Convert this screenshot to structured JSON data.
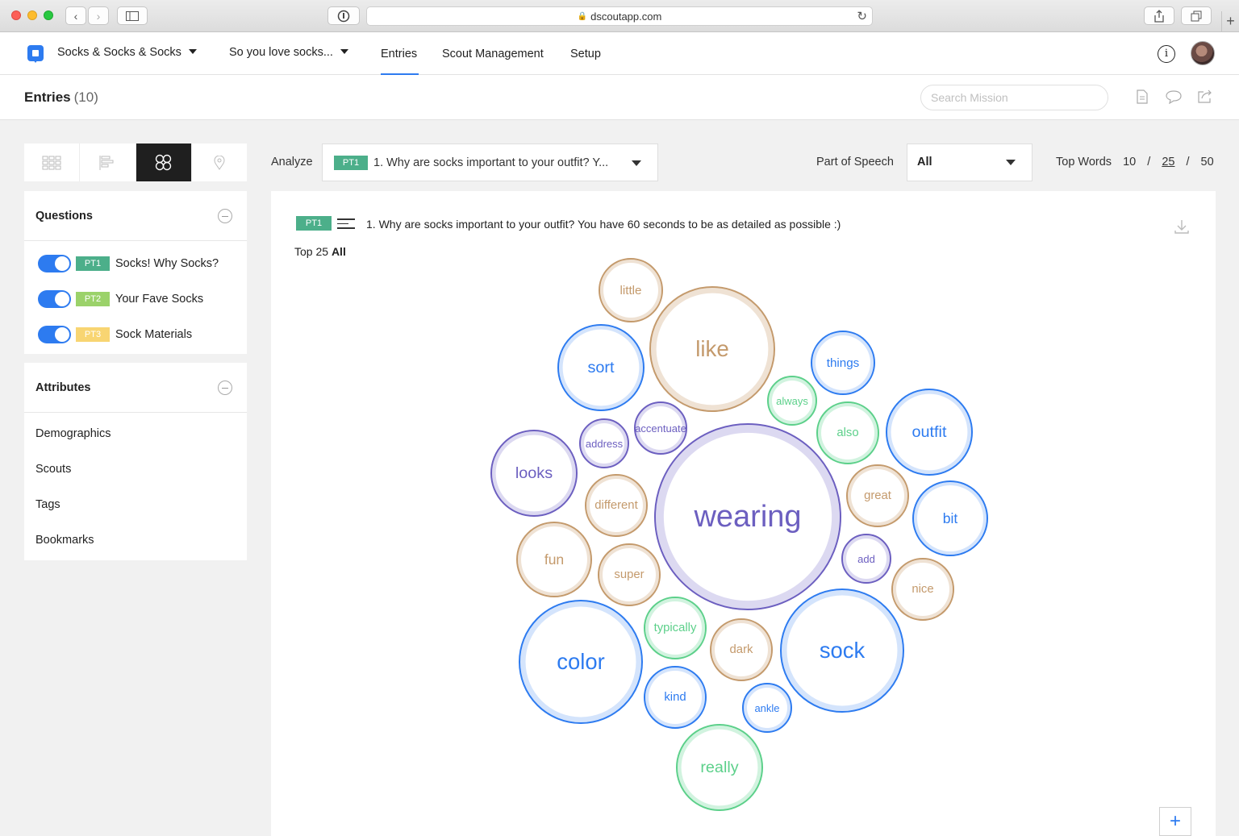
{
  "browser": {
    "url": "dscoutapp.com"
  },
  "nav": {
    "project": "Socks & Socks & Socks",
    "mission": "So you love socks...",
    "tabs": [
      "Entries",
      "Scout Management",
      "Setup"
    ],
    "info_icon": "info-icon"
  },
  "subheader": {
    "title": "Entries",
    "count": "(10)",
    "search_placeholder": "Search Mission"
  },
  "questions": {
    "heading": "Questions",
    "items": [
      {
        "badge": "PT1",
        "badge_color": "#4caf8a",
        "label": "Socks! Why Socks?"
      },
      {
        "badge": "PT2",
        "badge_color": "#9bd26a",
        "label": "Your Fave Socks"
      },
      {
        "badge": "PT3",
        "badge_color": "#f8d572",
        "label": "Sock Materials"
      }
    ]
  },
  "attributes": {
    "heading": "Attributes",
    "items": [
      "Demographics",
      "Scouts",
      "Tags",
      "Bookmarks"
    ]
  },
  "analyze": {
    "label": "Analyze",
    "badge": "PT1",
    "question": "1. Why are socks important to your outfit? Y...",
    "pos_label": "Part of Speech",
    "pos_value": "All",
    "top_words_label": "Top Words",
    "top_words_options": [
      "10",
      "25",
      "50"
    ],
    "top_words_selected": "25"
  },
  "panel": {
    "badge": "PT1",
    "question": "1. Why are socks important to your outfit? You have 60 seconds to be as detailed as possible :)",
    "top_label": "Top 25",
    "top_filter": "All"
  },
  "colors": {
    "blue": "#2d7bf0",
    "tan": "#c49a6c",
    "purple": "#6c5fc0",
    "green": "#5cd08a"
  },
  "bubbles": [
    {
      "word": "wearing",
      "color": "purple"
    },
    {
      "word": "like",
      "color": "tan"
    },
    {
      "word": "sock",
      "color": "blue"
    },
    {
      "word": "color",
      "color": "blue"
    },
    {
      "word": "sort",
      "color": "blue"
    },
    {
      "word": "outfit",
      "color": "blue"
    },
    {
      "word": "looks",
      "color": "purple"
    },
    {
      "word": "really",
      "color": "green"
    },
    {
      "word": "bit",
      "color": "blue"
    },
    {
      "word": "fun",
      "color": "tan"
    },
    {
      "word": "things",
      "color": "blue"
    },
    {
      "word": "little",
      "color": "tan"
    },
    {
      "word": "nice",
      "color": "tan"
    },
    {
      "word": "also",
      "color": "green"
    },
    {
      "word": "great",
      "color": "tan"
    },
    {
      "word": "different",
      "color": "tan"
    },
    {
      "word": "super",
      "color": "tan"
    },
    {
      "word": "typically",
      "color": "green"
    },
    {
      "word": "dark",
      "color": "tan"
    },
    {
      "word": "kind",
      "color": "blue"
    },
    {
      "word": "accentuate",
      "color": "purple"
    },
    {
      "word": "address",
      "color": "purple"
    },
    {
      "word": "always",
      "color": "green"
    },
    {
      "word": "add",
      "color": "purple"
    },
    {
      "word": "ankle",
      "color": "blue"
    }
  ]
}
